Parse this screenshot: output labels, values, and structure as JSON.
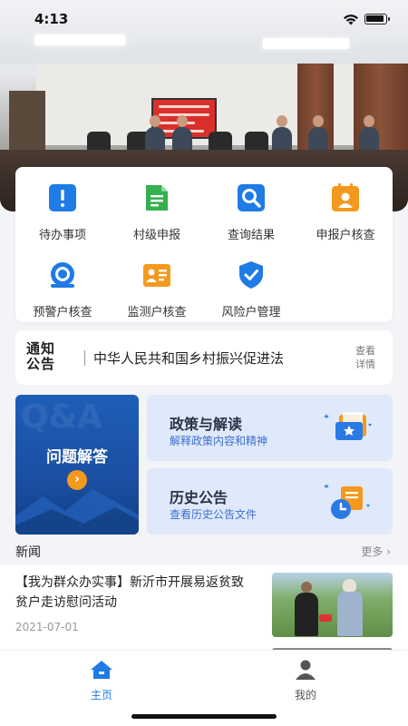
{
  "status_bar": {
    "time": "4:13"
  },
  "functions": [
    {
      "label": "待办事项",
      "icon": "todo-icon",
      "color": "#1f7be6"
    },
    {
      "label": "村级申报",
      "icon": "document-icon",
      "color": "#34b04f"
    },
    {
      "label": "查询结果",
      "icon": "search-icon",
      "color": "#1f7be6"
    },
    {
      "label": "申报户核查",
      "icon": "id-card-icon",
      "color": "#f39a1e"
    },
    {
      "label": "预警户核查",
      "icon": "alarm-bell-icon",
      "color": "#1f7be6"
    },
    {
      "label": "监测户核查",
      "icon": "profile-card-icon",
      "color": "#f39a1e"
    },
    {
      "label": "风险户管理",
      "icon": "shield-check-icon",
      "color": "#1f7be6"
    }
  ],
  "notice": {
    "logo_line1": "通知",
    "logo_line2": "公告",
    "text": "中华人民共和国乡村振兴促进法",
    "more_line1": "查看",
    "more_line2": "详情"
  },
  "qa_card": {
    "bg_text": "Q&A",
    "title": "问题解答"
  },
  "policy_cards": [
    {
      "title": "政策与解读",
      "subtitle": "解释政策内容和精神"
    },
    {
      "title": "历史公告",
      "subtitle": "查看历史公告文件"
    }
  ],
  "news": {
    "heading": "新闻",
    "more": "更多",
    "items": [
      {
        "title": "【我为群众办实事】新沂市开展易返贫致贫户走访慰问活动",
        "date": "2021-07-01"
      }
    ]
  },
  "tabbar": {
    "items": [
      {
        "label": "主页",
        "active": true
      },
      {
        "label": "我的",
        "active": false
      }
    ]
  },
  "colors": {
    "primary": "#1f7be6",
    "orange": "#f39a1e",
    "green": "#34b04f",
    "tab_inactive": "#555555"
  }
}
